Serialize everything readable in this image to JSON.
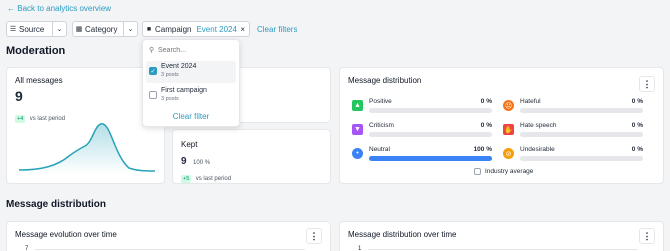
{
  "nav": {
    "back_label": "Back to analytics overview"
  },
  "filters": {
    "source": "Source",
    "category": "Category",
    "campaign": "Campaign",
    "campaign_value": "Event 2024",
    "clear": "Clear filters"
  },
  "dropdown": {
    "search_placeholder": "Search...",
    "items": [
      {
        "title": "Event 2024",
        "sub": "3 posts",
        "checked": true
      },
      {
        "title": "First campaign",
        "sub": "3 posts",
        "checked": false
      }
    ],
    "clear": "Clear filter"
  },
  "moderation": {
    "title": "Moderation",
    "all_messages": {
      "label": "All messages",
      "value": "9",
      "badge": "+4",
      "suffix": "vs last period"
    },
    "kept": {
      "label": "Kept",
      "value": "9",
      "percent": "100 %",
      "badge": "+5",
      "suffix": "vs last period"
    }
  },
  "distribution": {
    "title": "Message distribution",
    "rows": [
      {
        "label": "Positive",
        "value": "0 %",
        "pct": 0,
        "icon": "thumbs-up-icon",
        "color": "#22c55e"
      },
      {
        "label": "Hateful",
        "value": "0 %",
        "pct": 0,
        "icon": "angry-face-icon",
        "color": "#f97316"
      },
      {
        "label": "Criticism",
        "value": "0 %",
        "pct": 0,
        "icon": "thumbs-down-icon",
        "color": "#a855f7"
      },
      {
        "label": "Hate speech",
        "value": "0 %",
        "pct": 0,
        "icon": "stop-hand-icon",
        "color": "#ef4444"
      },
      {
        "label": "Neutral",
        "value": "100 %",
        "pct": 100,
        "icon": "neutral-face-icon",
        "color": "#3b82f6"
      },
      {
        "label": "Undesirable",
        "value": "0 %",
        "pct": 0,
        "icon": "forbidden-icon",
        "color": "#f59e0b"
      }
    ],
    "industry_average": "Industry average"
  },
  "section2": {
    "title": "Message distribution",
    "evolution_title": "Message evolution over time",
    "evolution_tick": "7",
    "dist_time_title": "Message distribution over time",
    "dist_time_tick": "1"
  },
  "colors": {
    "accent": "#2a9bbf",
    "chart_line": "#26a3b8",
    "bar": "#3b82f6"
  }
}
